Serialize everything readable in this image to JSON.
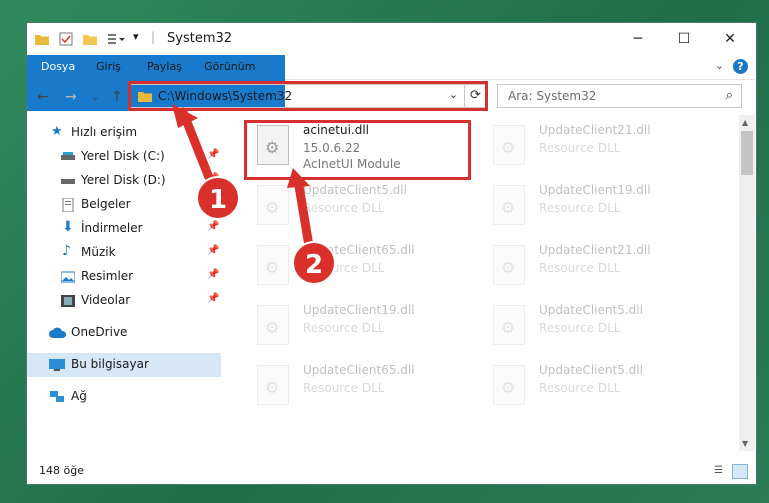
{
  "window": {
    "title": "System32",
    "minimize": "─",
    "maximize": "☐",
    "close": "✕"
  },
  "ribbon": {
    "tabs": [
      "Dosya",
      "Giriş",
      "Paylaş",
      "Görünüm"
    ],
    "help": "?"
  },
  "nav": {
    "address": "C:\\Windows\\System32",
    "search_placeholder": "Ara: System32"
  },
  "sidebar": {
    "items": [
      {
        "label": "Hızlı erişim"
      },
      {
        "label": "Yerel Disk (C:)"
      },
      {
        "label": "Yerel Disk (D:)"
      },
      {
        "label": "Belgeler"
      },
      {
        "label": "İndirmeler"
      },
      {
        "label": "Müzik"
      },
      {
        "label": "Resimler"
      },
      {
        "label": "Videolar"
      },
      {
        "label": "OneDrive"
      },
      {
        "label": "Bu bilgisayar"
      },
      {
        "label": "Ağ"
      }
    ]
  },
  "files": [
    {
      "name": "acinetui.dll",
      "version": "15.0.6.22",
      "desc": "AcInetUI Module"
    },
    {
      "name": "UpdateClient21.dll",
      "desc": "Resource DLL"
    },
    {
      "name": "UpdateClient5.dll",
      "desc": "Resource DLL"
    },
    {
      "name": "UpdateClient19.dll",
      "desc": "Resource DLL"
    },
    {
      "name": "UpdateClient65.dll",
      "desc": "Resource DLL"
    },
    {
      "name": "UpdateClient21.dll",
      "desc": "Resource DLL"
    },
    {
      "name": "UpdateClient19.dll",
      "desc": "Resource DLL"
    },
    {
      "name": "UpdateClient5.dll",
      "desc": "Resource DLL"
    },
    {
      "name": "UpdateClient65.dll",
      "desc": "Resource DLL"
    },
    {
      "name": "UpdateClient5.dll",
      "desc": "Resource DLL"
    }
  ],
  "status": {
    "count": "148 öğe"
  },
  "annotations": {
    "badge1": "1",
    "badge2": "2"
  },
  "colors": {
    "accent": "#1979ca",
    "highlight": "#d62f2f",
    "selection": "#d6e8f8"
  }
}
